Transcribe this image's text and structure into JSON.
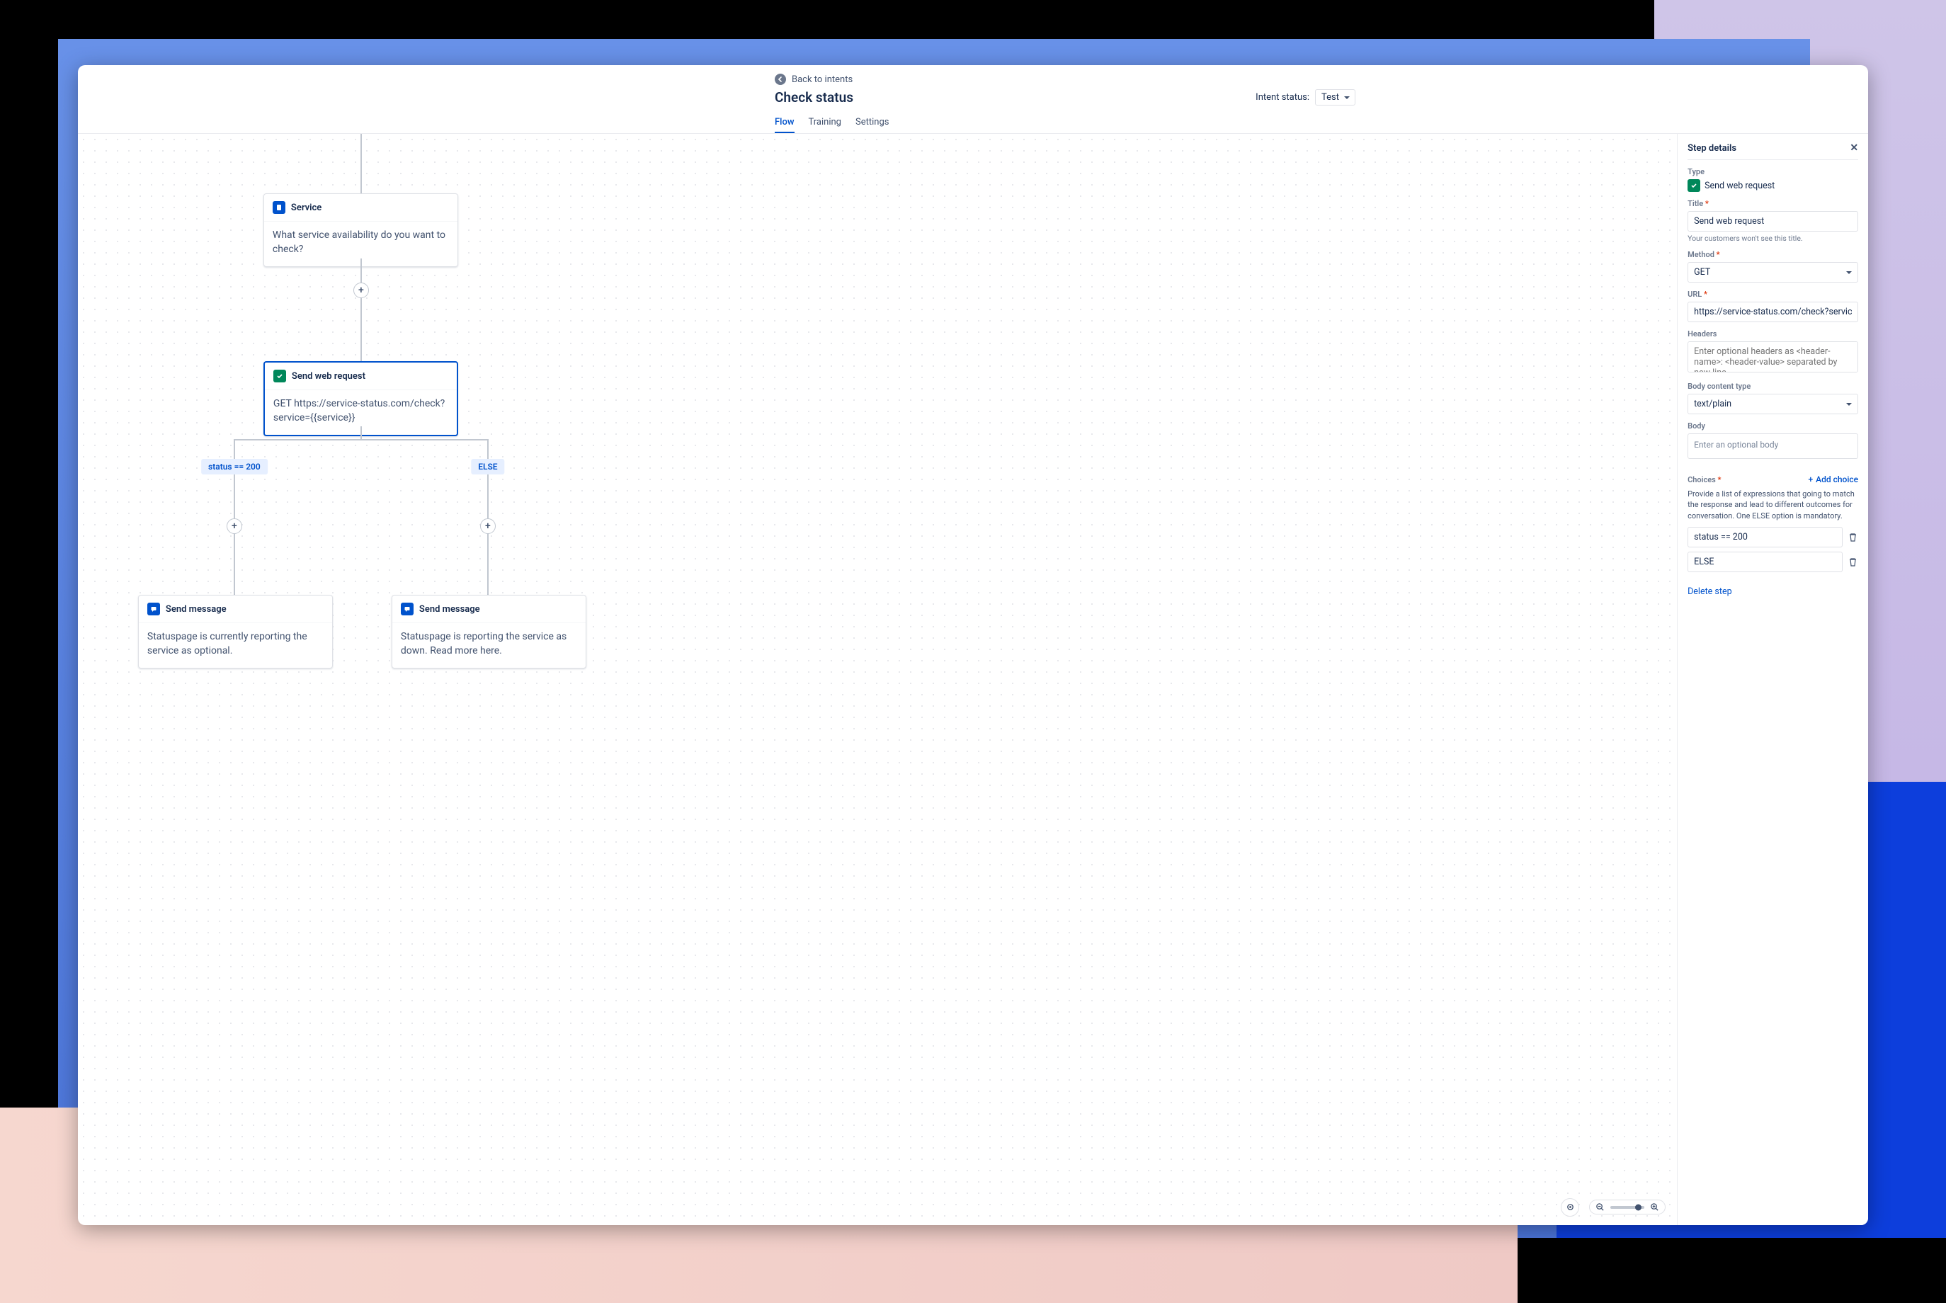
{
  "header": {
    "back_label": "Back to intents",
    "title": "Check status",
    "intent_status_label": "Intent status:",
    "intent_status_value": "Test",
    "tabs": {
      "flow": "Flow",
      "training": "Training",
      "settings": "Settings"
    }
  },
  "nodes": {
    "service": {
      "title": "Service",
      "body": "What service availability do you want to check?"
    },
    "web_request": {
      "title": "Send web request",
      "body": "GET https://service-status.com/check?service={{service}}"
    },
    "branch_left": "status == 200",
    "branch_right": "ELSE",
    "msg_left": {
      "title": "Send message",
      "body": "Statuspage is currently reporting the service as optional."
    },
    "msg_right": {
      "title": "Send message",
      "body": "Statuspage is reporting the service as down. Read more here."
    }
  },
  "panel": {
    "title": "Step details",
    "type_label": "Type",
    "type_value": "Send web request",
    "title_label": "Title",
    "title_value": "Send web request",
    "title_hint": "Your customers won't see this title.",
    "method_label": "Method",
    "method_value": "GET",
    "url_label": "URL",
    "url_value": "https://service-status.com/check?service={{service}}",
    "headers_label": "Headers",
    "headers_placeholder": "Enter optional headers as <header-name>: <header-value> separated by new line",
    "body_type_label": "Body content type",
    "body_type_value": "text/plain",
    "body_label": "Body",
    "body_placeholder": "Enter an optional body",
    "choices_label": "Choices",
    "add_choice": "Add choice",
    "choices_desc": "Provide a list of expressions that going to match the response and lead to different outcomes for conversation. One ELSE option is mandatory.",
    "choice1": "status == 200",
    "choice2": "ELSE",
    "delete_step": "Delete step"
  }
}
